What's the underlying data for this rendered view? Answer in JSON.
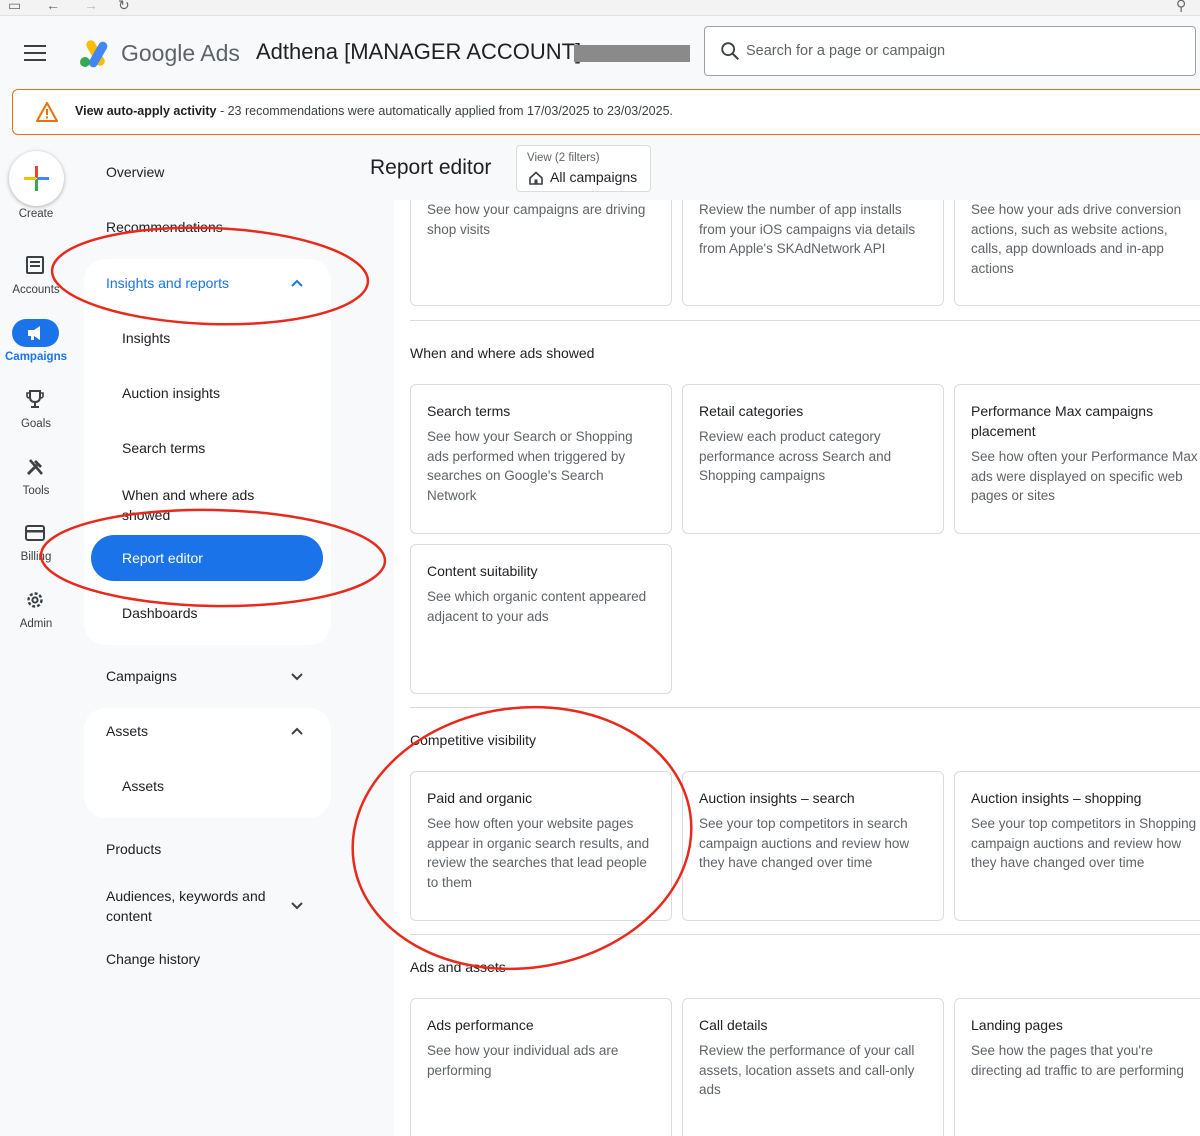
{
  "header": {
    "brand_google": "Google",
    "brand_ads": "Ads",
    "account_name": "Adthena [MANAGER ACCOUNT]",
    "search_placeholder": "Search for a page or campaign"
  },
  "alert": {
    "strong_text": "View auto-apply activity",
    "text": " - 23 recommendations were automatically applied from 17/03/2025 to 23/03/2025."
  },
  "rail": {
    "create": "Create",
    "accounts": "Accounts",
    "campaigns": "Campaigns",
    "goals": "Goals",
    "tools": "Tools",
    "billing": "Billing",
    "admin": "Admin"
  },
  "nav": {
    "overview": "Overview",
    "recommendations": "Recommendations",
    "insights_reports": "Insights and reports",
    "insights": "Insights",
    "auction_insights": "Auction insights",
    "search_terms": "Search terms",
    "when_where": "When and where ads showed",
    "report_editor": "Report editor",
    "dashboards": "Dashboards",
    "campaigns": "Campaigns",
    "assets_group": "Assets",
    "assets": "Assets",
    "products": "Products",
    "audiences": "Audiences, keywords and content",
    "change_history": "Change history"
  },
  "main": {
    "title": "Report editor",
    "view_label": "View (2 filters)",
    "view_value": "All campaigns",
    "top_cards": [
      {
        "desc": "See how your campaigns are driving shop visits"
      },
      {
        "desc": "Review the number of app installs from your iOS campaigns via details from Apple's SKAdNetwork API"
      },
      {
        "desc": "See how your ads drive conversion actions, such as website actions, calls, app downloads and in-app actions"
      }
    ],
    "sections": [
      {
        "title": "When and where ads showed",
        "cards": [
          {
            "title": "Search terms",
            "desc": "See how your Search or Shopping ads performed when triggered by searches on Google's Search Network"
          },
          {
            "title": "Retail categories",
            "desc": "Review each product category performance across Search and Shopping campaigns"
          },
          {
            "title": "Performance Max campaigns placement",
            "desc": "See how often your Performance Max ads were displayed on specific web pages or sites"
          },
          {
            "title": "Content suitability",
            "desc": "See which organic content appeared adjacent to your ads"
          }
        ]
      },
      {
        "title": "Competitive visibility",
        "cards": [
          {
            "title": "Paid and organic",
            "desc": "See how often your website pages appear in organic search results, and review the searches that lead people to them"
          },
          {
            "title": "Auction insights – search",
            "desc": "See your top competitors in search campaign auctions and review how they have changed over time"
          },
          {
            "title": "Auction insights – shopping",
            "desc": "See your top competitors in Shopping campaign auctions and review how they have changed over time"
          }
        ]
      },
      {
        "title": "Ads and assets",
        "cards": [
          {
            "title": "Ads performance",
            "desc": "See how your individual ads are performing"
          },
          {
            "title": "Call details",
            "desc": "Review the performance of your call assets, location assets and call-only ads"
          },
          {
            "title": "Landing pages",
            "desc": "See how the pages that you're directing ad traffic to are performing"
          }
        ]
      }
    ]
  },
  "colors": {
    "primary": "#1a73e8",
    "warning": "#e8710a",
    "annotation": "#e8291c"
  }
}
